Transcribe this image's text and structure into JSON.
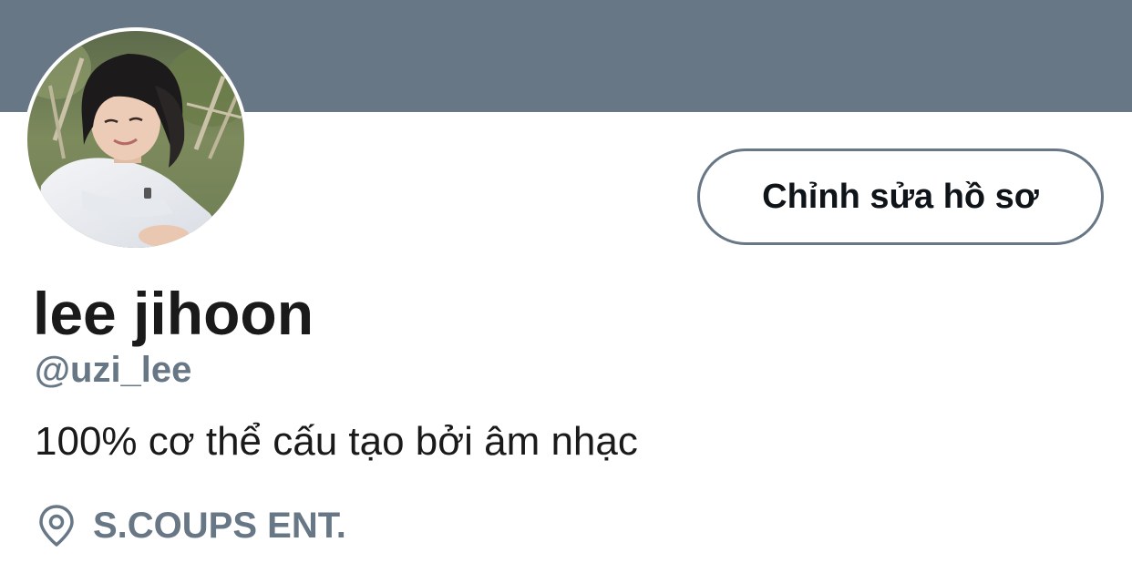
{
  "profile": {
    "display_name": "lee jihoon",
    "handle": "@uzi_lee",
    "bio": "100% cơ thể cấu tạo bởi âm nhạc",
    "location": "S.COUPS ENT.",
    "location_icon": "location-pin-icon"
  },
  "actions": {
    "edit_profile_label": "Chỉnh sửa hồ sơ"
  },
  "colors": {
    "banner": "#687785",
    "secondary_text": "#687785",
    "primary_text": "#1a1a1a",
    "button_border": "#687785"
  }
}
